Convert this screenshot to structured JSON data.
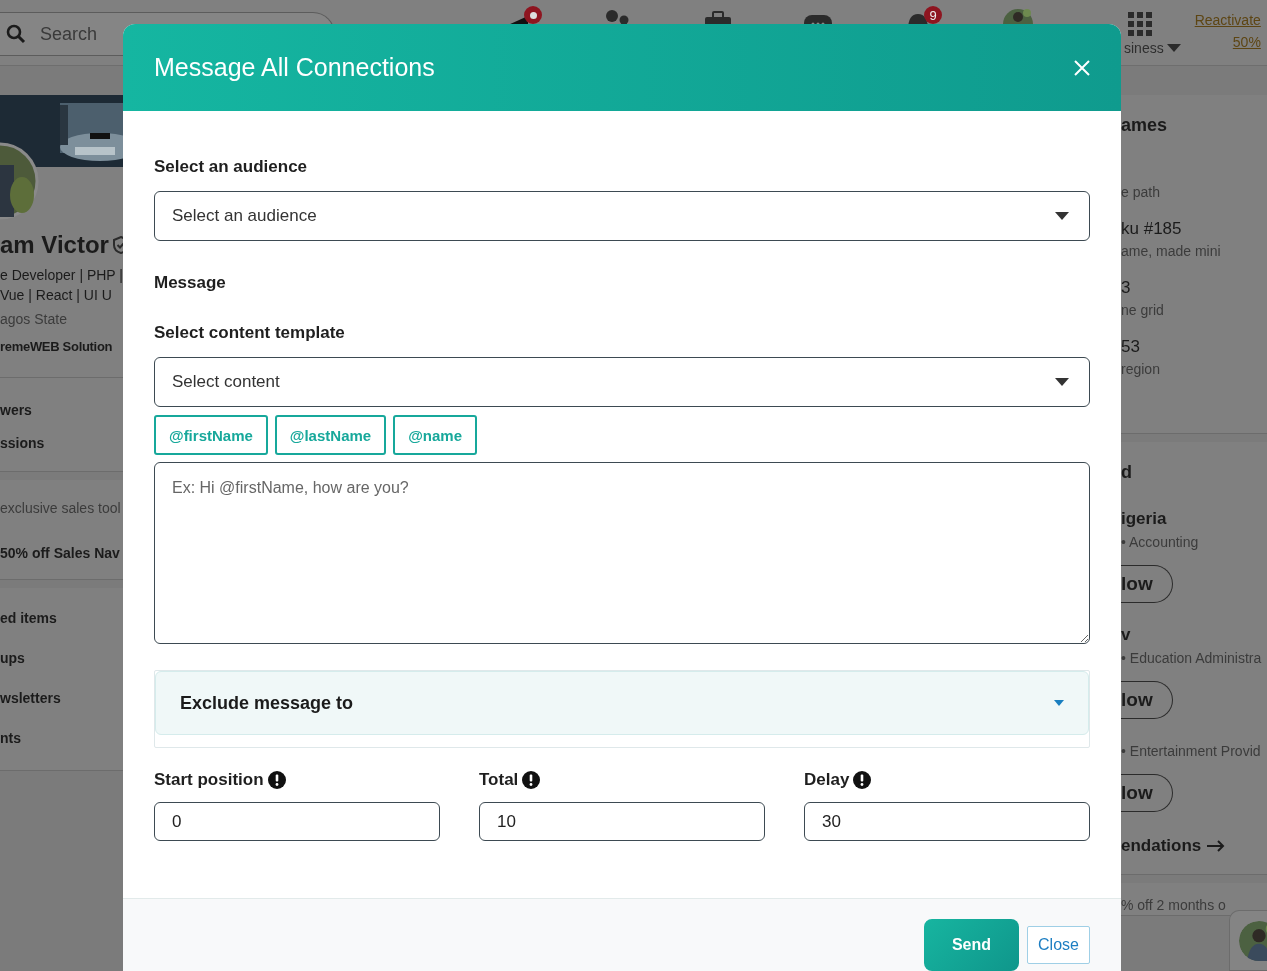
{
  "background": {
    "search": {
      "placeholder": "Search"
    },
    "nav": [
      {
        "kind": "icon",
        "dot": true
      },
      {
        "kind": "icon",
        "dot": false
      },
      {
        "kind": "icon",
        "dot": false
      },
      {
        "kind": "icon",
        "dot": false
      },
      {
        "kind": "icon",
        "dot": false,
        "badge": "9"
      },
      {
        "kind": "avatar",
        "dot": false
      }
    ],
    "business_menu": "siness",
    "premium": [
      "Reactivate",
      "50%"
    ],
    "profile": {
      "name": "am Victor",
      "verified": true,
      "headline": [
        "e Developer | PHP |",
        "Vue | React | UI U"
      ],
      "location": "agos State",
      "company": "remeWEB Solution"
    },
    "stats": [
      "wers",
      "ssions"
    ],
    "promo": [
      "exclusive sales tool",
      "50% off Sales Nav"
    ],
    "links": [
      "ed items",
      "ups",
      "wsletters",
      "nts"
    ],
    "games": {
      "title": "ames",
      "items": [
        {
          "subtitle": "e path"
        },
        {
          "title": "ku #185",
          "subtitle": "ame, made mini"
        },
        {
          "title": "3",
          "subtitle": "ne grid"
        },
        {
          "title": "53",
          "subtitle": "region"
        }
      ]
    },
    "follow": {
      "title": "d",
      "people": [
        {
          "name": "igeria",
          "detail": "• Accounting",
          "button": "low"
        },
        {
          "name": "v",
          "detail": "• Education Administra",
          "button": "low"
        },
        {
          "detail": "• Entertainment Provid",
          "button": "low"
        }
      ],
      "more": "endations"
    },
    "offer": "% off 2 months o"
  },
  "modal": {
    "title": "Message All Connections",
    "audience": {
      "label": "Select an audience",
      "placeholder": "Select an audience"
    },
    "message_label": "Message",
    "template": {
      "label": "Select content template",
      "placeholder": "Select content"
    },
    "tokens": [
      "@firstName",
      "@lastName",
      "@name"
    ],
    "message": {
      "placeholder": "Ex: Hi @firstName, how are you?"
    },
    "exclude": {
      "label": "Exclude message to",
      "expanded": false
    },
    "numbers": [
      {
        "label": "Start position",
        "value": "0"
      },
      {
        "label": "Total",
        "value": "10"
      },
      {
        "label": "Delay",
        "value": "30"
      }
    ],
    "buttons": [
      {
        "label": "Send",
        "kind": "primary"
      },
      {
        "label": "Close",
        "kind": "secondary"
      }
    ]
  }
}
